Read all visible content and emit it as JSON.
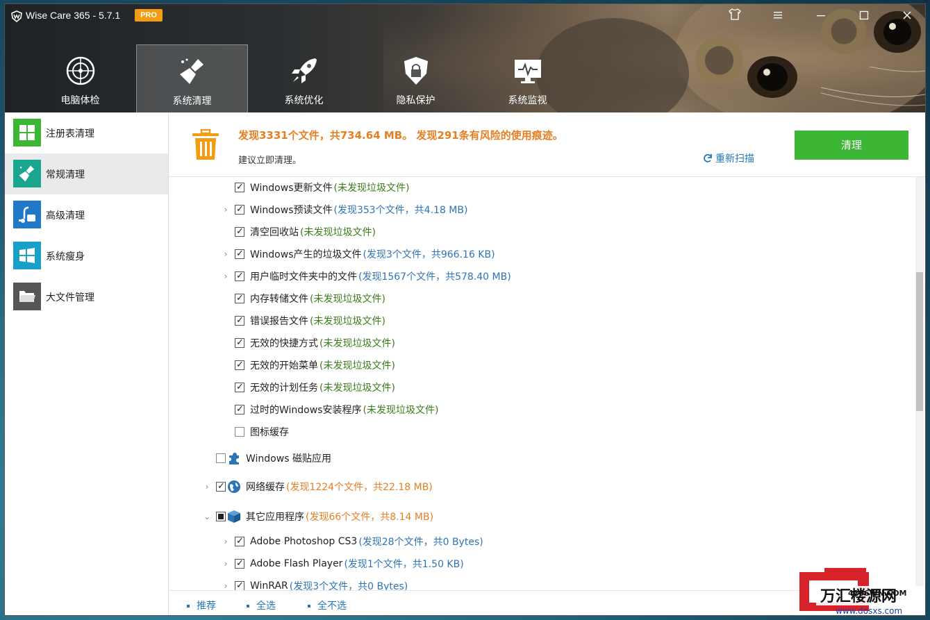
{
  "app": {
    "title": "Wise Care 365 - 5.7.1",
    "badge": "PRO"
  },
  "window_controls": {
    "skin": "skin-icon",
    "menu": "menu-icon",
    "minimize": "minimize-icon",
    "maximize": "maximize-icon",
    "close": "close-icon"
  },
  "nav": {
    "tabs": [
      {
        "label": "电脑体检",
        "icon": "radar-icon"
      },
      {
        "label": "系统清理",
        "icon": "broom-icon"
      },
      {
        "label": "系统优化",
        "icon": "rocket-icon"
      },
      {
        "label": "隐私保护",
        "icon": "shield-lock-icon"
      },
      {
        "label": "系统监视",
        "icon": "monitor-pulse-icon"
      }
    ],
    "active_index": 1
  },
  "sidebar": {
    "items": [
      {
        "label": "注册表清理",
        "icon": "registry-icon",
        "color": "#3db535"
      },
      {
        "label": "常规清理",
        "icon": "broom-icon",
        "color": "#1aa58f"
      },
      {
        "label": "高级清理",
        "icon": "vacuum-icon",
        "color": "#1f78c8"
      },
      {
        "label": "系统瘦身",
        "icon": "windows-icon",
        "color": "#1aa0c8"
      },
      {
        "label": "大文件管理",
        "icon": "folder-icon",
        "color": "#555555"
      }
    ],
    "active_index": 1
  },
  "summary": {
    "headline": "发现3331个文件，共734.64 MB。 发现291条有风险的使用痕迹。",
    "subtext": "建议立即清理。",
    "rescan_label": "重新扫描",
    "clean_label": "清理",
    "accent_color": "#e67e22",
    "clean_color": "#3db535"
  },
  "list": {
    "windows_items": [
      {
        "name": "Windows更新文件",
        "status": "(未发现垃圾文件)",
        "status_type": "green",
        "expandable": false,
        "checked": true
      },
      {
        "name": "Windows预读文件",
        "status": "(发现353个文件，共4.18 MB)",
        "status_type": "blue",
        "expandable": true,
        "checked": true
      },
      {
        "name": "清空回收站",
        "status": "(未发现垃圾文件)",
        "status_type": "green",
        "expandable": false,
        "checked": true
      },
      {
        "name": "Windows产生的垃圾文件",
        "status": "(发现3个文件，共966.16 KB)",
        "status_type": "blue",
        "expandable": true,
        "checked": true
      },
      {
        "name": "用户临时文件夹中的文件",
        "status": "(发现1567个文件，共578.40 MB)",
        "status_type": "blue",
        "expandable": true,
        "checked": true
      },
      {
        "name": "内存转储文件",
        "status": "(未发现垃圾文件)",
        "status_type": "green",
        "expandable": false,
        "checked": true
      },
      {
        "name": "错误报告文件",
        "status": "(未发现垃圾文件)",
        "status_type": "green",
        "expandable": false,
        "checked": true
      },
      {
        "name": "无效的快捷方式",
        "status": "(未发现垃圾文件)",
        "status_type": "green",
        "expandable": false,
        "checked": true
      },
      {
        "name": "无效的开始菜单",
        "status": "(未发现垃圾文件)",
        "status_type": "green",
        "expandable": false,
        "checked": true
      },
      {
        "name": "无效的计划任务",
        "status": "(未发现垃圾文件)",
        "status_type": "green",
        "expandable": false,
        "checked": true
      },
      {
        "name": "过时的Windows安装程序",
        "status": "(未发现垃圾文件)",
        "status_type": "green",
        "expandable": false,
        "checked": true
      },
      {
        "name": "图标缓存",
        "status": "",
        "status_type": "green",
        "expandable": false,
        "checked": false
      }
    ],
    "categories": [
      {
        "name": "Windows 磁贴应用",
        "status": "",
        "icon": "puzzle-icon",
        "expand": "none",
        "check": "unchecked"
      },
      {
        "name": "网络缓存",
        "status": "(发现1224个文件，共22.18 MB)",
        "icon": "globe-icon",
        "expand": "collapsed",
        "check": "checked"
      },
      {
        "name": "其它应用程序",
        "status": "(发现66个文件，共8.14 MB)",
        "icon": "box-icon",
        "expand": "expanded",
        "check": "partial"
      }
    ],
    "app_items": [
      {
        "name": "Adobe Photoshop CS3",
        "status": "(发现28个文件，共0 Bytes)",
        "checked": true
      },
      {
        "name": "Adobe Flash Player",
        "status": "(发现1个文件，共1.50 KB)",
        "checked": true
      },
      {
        "name": "WinRAR",
        "status": "(发现3个文件，共0 Bytes)",
        "checked": true
      }
    ]
  },
  "footer": {
    "recommend": "推荐",
    "select_all": "全选",
    "select_none": "全不选"
  },
  "watermark": {
    "text_main": "万汇楼源网",
    "text_url": "www.dosxs.com",
    "text_code": "4266WN.COM"
  }
}
